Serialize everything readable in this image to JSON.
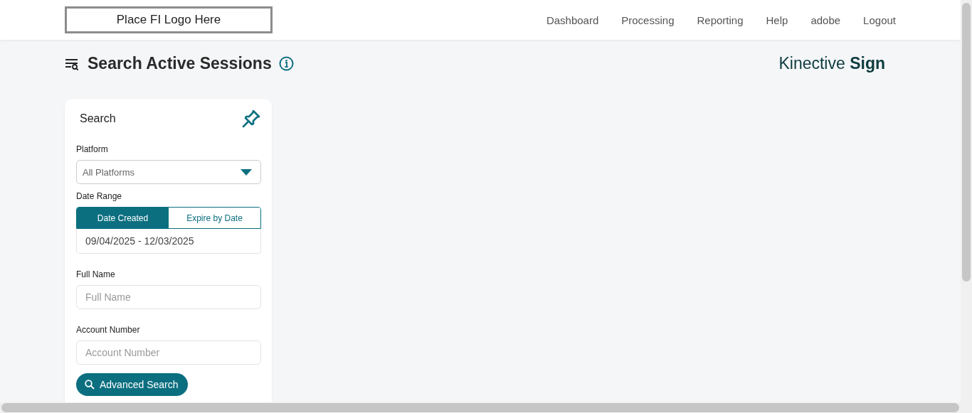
{
  "header": {
    "logo_placeholder": "Place FI Logo Here",
    "nav": [
      "Dashboard",
      "Processing",
      "Reporting",
      "Help",
      "adobe",
      "Logout"
    ]
  },
  "page": {
    "title": "Search Active Sessions",
    "brand": "Kinective **Sign**"
  },
  "search_panel": {
    "title": "Search",
    "platform": {
      "label": "Platform",
      "value": "All Platforms"
    },
    "date_range": {
      "label": "Date Range",
      "tabs": [
        {
          "label": "Date Created",
          "selected": true
        },
        {
          "label": "Expire by Date",
          "selected": false
        }
      ],
      "value": "09/04/2025 - 12/03/2025"
    },
    "fields": [
      {
        "label": "Full Name",
        "placeholder": "Full Name"
      },
      {
        "label": "Account Number",
        "placeholder": "Account Number"
      }
    ],
    "button": "Advanced Search"
  }
}
